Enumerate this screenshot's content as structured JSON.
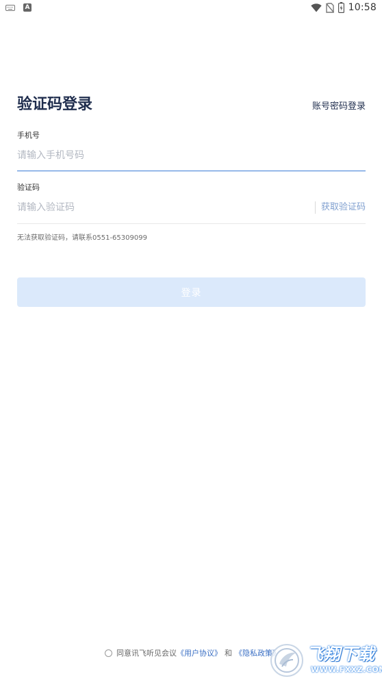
{
  "status_bar": {
    "time": "10:58",
    "left_icons": [
      "keyboard-icon",
      "a-badge"
    ],
    "right_icons": [
      "wifi-icon",
      "no-sim-icon",
      "battery-icon"
    ],
    "a_badge_text": "A"
  },
  "login": {
    "title": "验证码登录",
    "switch_mode_label": "账号密码登录",
    "phone_label": "手机号",
    "phone_placeholder": "请输入手机号码",
    "phone_value": "",
    "code_label": "验证码",
    "code_placeholder": "请输入验证码",
    "code_value": "",
    "get_code_label": "获取验证码",
    "help_text": "无法获取验证码，请联系0551-65309099",
    "submit_label": "登录"
  },
  "agreement": {
    "prefix": "同意讯飞听见会议",
    "user_agreement": "《用户协议》",
    "and": "和",
    "privacy_policy": "《隐私政策》"
  },
  "watermark": {
    "title": "飞翔下载",
    "url": "WWW.FXXZ.COM"
  },
  "colors": {
    "primary": "#3a7bd5",
    "title": "#1f2d4d",
    "button_disabled": "#dbe9fb",
    "link": "#3a6fc4"
  }
}
